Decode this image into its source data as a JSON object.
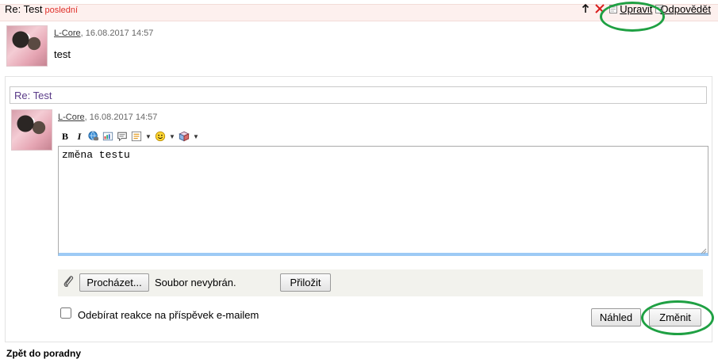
{
  "post": {
    "title": "Re: Test",
    "badge": "poslední",
    "actions": {
      "edit": "Upravit",
      "reply": "Odpovědět"
    },
    "author": "L-Core",
    "date": ", 16.08.2017 14:57",
    "body": "test"
  },
  "edit_form": {
    "subject": "Re: Test",
    "author": "L-Core",
    "date": ", 16.08.2017 14:57",
    "toolbar": {
      "bold": "B",
      "italic": "I"
    },
    "content": "změna testu",
    "browse_label": "Procházet...",
    "file_status": "Soubor nevybrán.",
    "attach_label": "Přiložit",
    "subscribe_label": "Odebírat reakce na příspěvek e-mailem",
    "preview_label": "Náhled",
    "submit_label": "Změnit"
  },
  "footer": {
    "back_link": "Zpět do poradny"
  },
  "icons": [
    "up-arrow-icon",
    "delete-icon",
    "edit-icon",
    "attach-icon",
    "link-icon",
    "image-icon",
    "quote-icon",
    "list-icon",
    "smiley-icon",
    "media-icon"
  ],
  "colors": {
    "header_bg": "#fdf0ee",
    "badge": "#e0312b",
    "highlight": "#1fa043",
    "editor_accent": "#9dcaf5"
  }
}
